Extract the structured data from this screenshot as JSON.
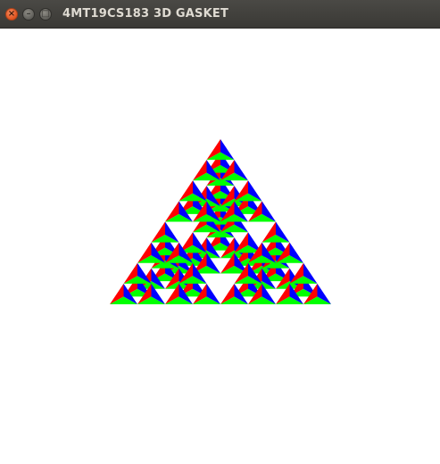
{
  "window": {
    "title": "4MT19CS183 3D GASKET",
    "buttons": {
      "close_glyph": "×",
      "minimize_glyph": "–",
      "maximize_glyph": "□"
    }
  },
  "canvas": {
    "background": "#ffffff",
    "gasket": {
      "type": "sierpinski-3d",
      "face_colors": [
        "#ff0000",
        "#00ff00",
        "#0000ff"
      ]
    }
  }
}
